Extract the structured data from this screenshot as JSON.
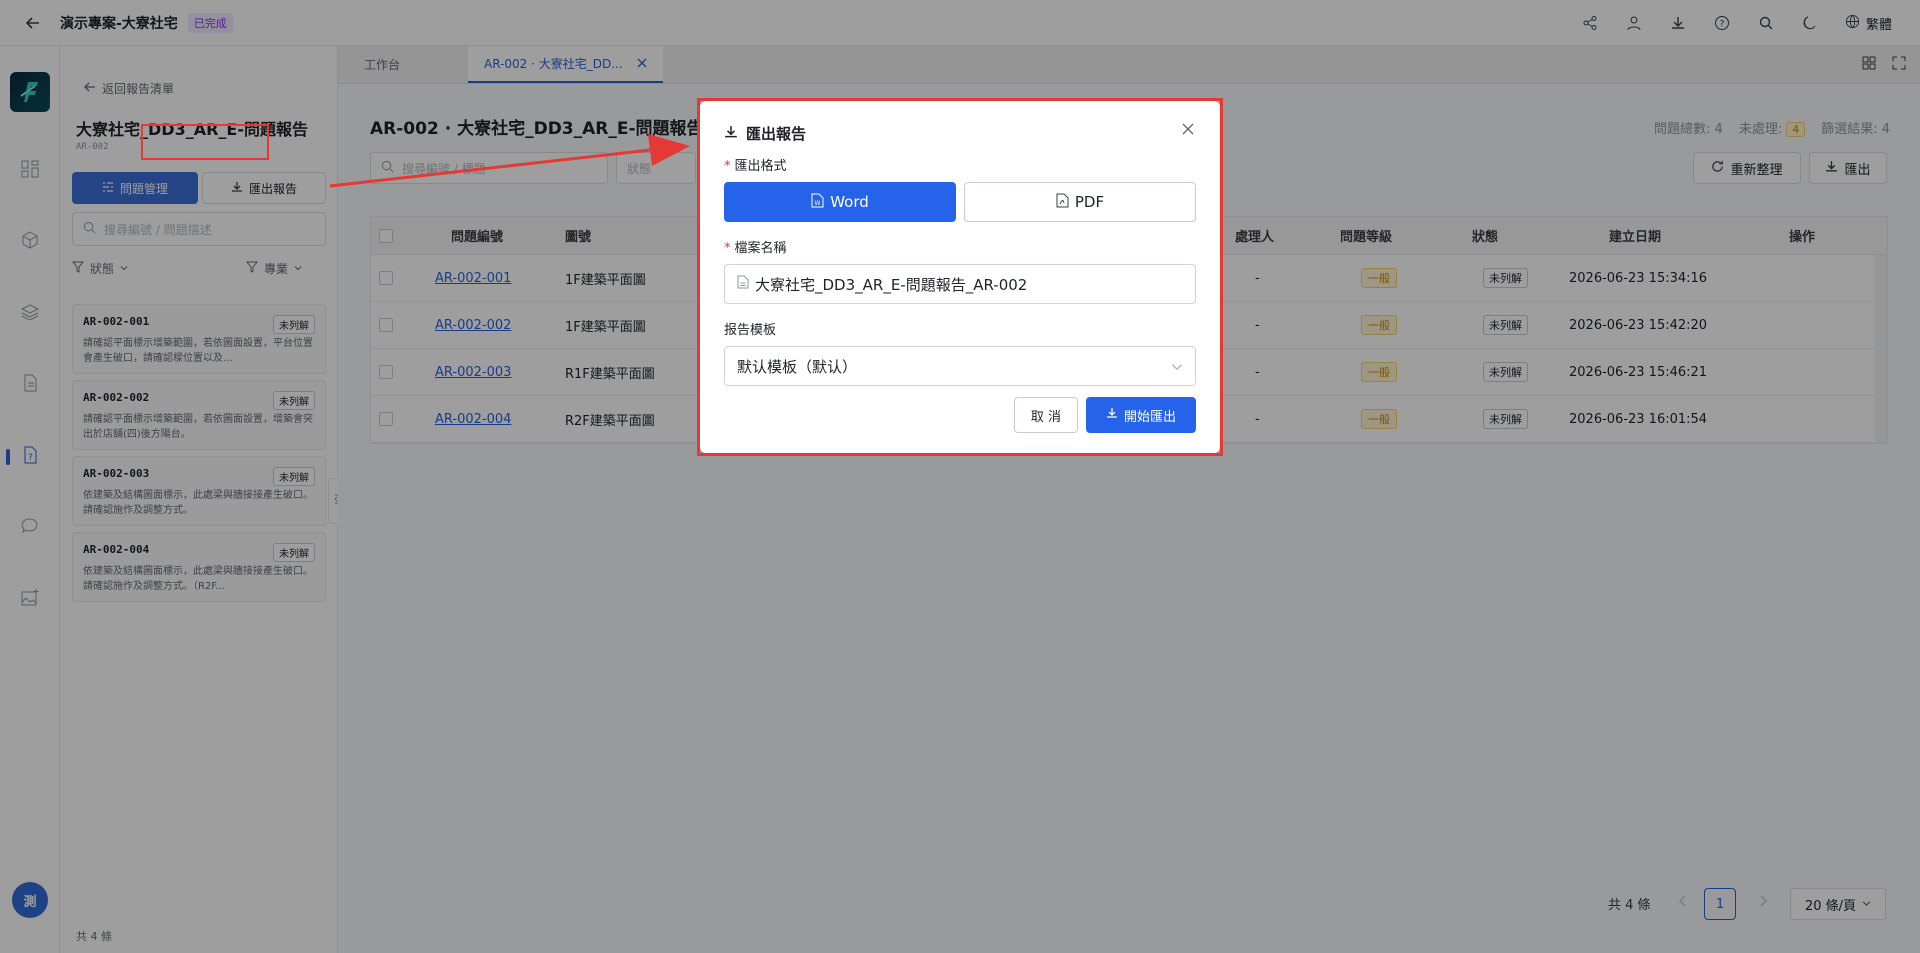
{
  "topbar": {
    "project_title": "演示專案-大寮社宅",
    "status_badge": "已完成",
    "language": "繁體",
    "icons": [
      "share-icon",
      "team-icon",
      "download-icon",
      "help-icon",
      "search-icon",
      "moon-icon",
      "globe-icon"
    ]
  },
  "rail": {
    "icons": [
      "dashboard-icon",
      "cube-icon",
      "layers-icon",
      "document-icon",
      "issue-icon",
      "chat-icon",
      "image-icon"
    ],
    "avatar_text": "測"
  },
  "panel": {
    "back_link": "返回報告清單",
    "report_title": "大寮社宅_DD3_AR_E-問題報告",
    "report_code": "AR-002",
    "manage_btn": "問題管理",
    "export_btn": "匯出報告",
    "search_placeholder": "搜尋編號 / 問題描述",
    "filter_status": "狀態",
    "filter_discipline": "專業",
    "cards": [
      {
        "code": "AR-002-001",
        "status": "未列解",
        "desc": "請確認平面標示增築範圍，若依圖面設置，平台位置會產生破口，請確認樑位置以及..."
      },
      {
        "code": "AR-002-002",
        "status": "未列解",
        "desc": "請確認平面標示增築範圍，若依圖面設置，增築會突出於店舖(四)後方陽台。"
      },
      {
        "code": "AR-002-003",
        "status": "未列解",
        "desc": "依建築及結構圖面標示，此處梁與牆接接產生破口。請確認施作及調整方式。"
      },
      {
        "code": "AR-002-004",
        "status": "未列解",
        "desc": "依建築及結構圖面標示，此處梁與牆接接產生破口。請確認施作及調整方式。（R2F..."
      }
    ],
    "count": "共 4 條"
  },
  "tabs": {
    "workbench": "工作台",
    "active": "AR-002 · 大寮社宅_DD..."
  },
  "main": {
    "title": "AR-002 · 大寮社宅_DD3_AR_E-問題報告",
    "stats": {
      "total_label": "問題總數: 4",
      "pending_label": "未處理:",
      "pending_value": "4",
      "filtered_label": "篩選結果: 4"
    },
    "search_placeholder": "搜尋編號 / 標題",
    "status_placeholder": "狀態",
    "refresh_btn": "重新整理",
    "export_btn": "匯出",
    "columns": {
      "number": "問題編號",
      "drawing": "圖號",
      "handler": "處理人",
      "level": "問題等級",
      "status": "狀態",
      "created": "建立日期",
      "actions": "操作"
    },
    "rows": [
      {
        "number": "AR-002-001",
        "drawing": "1F建築平面圖",
        "handler": "-",
        "level": "一般",
        "status": "未列解",
        "created": "2026-06-23 15:34:16"
      },
      {
        "number": "AR-002-002",
        "drawing": "1F建築平面圖",
        "handler": "-",
        "level": "一般",
        "status": "未列解",
        "created": "2026-06-23 15:42:20"
      },
      {
        "number": "AR-002-003",
        "drawing": "R1F建築平面圖",
        "handler": "-",
        "level": "一般",
        "status": "未列解",
        "created": "2026-06-23 15:46:21"
      },
      {
        "number": "AR-002-004",
        "drawing": "R2F建築平面圖",
        "handler": "-",
        "level": "一般",
        "status": "未列解",
        "created": "2026-06-23 16:01:54"
      }
    ],
    "pager": {
      "total": "共 4 條",
      "page": "1",
      "size": "20 條/頁"
    }
  },
  "modal": {
    "title": "匯出報告",
    "format_label": "匯出格式",
    "format_word": "Word",
    "format_pdf": "PDF",
    "filename_label": "檔案名稱",
    "filename_value": "大寮社宅_DD3_AR_E-問題報告_AR-002",
    "template_label": "报告模板",
    "template_value": "默认模板（默认）",
    "cancel": "取 消",
    "start": "開始匯出"
  },
  "colors": {
    "primary": "#2563eb",
    "annotation_red": "#e53935",
    "level_bg": "#fff4d6",
    "badge_purple": "#7c3aed"
  }
}
